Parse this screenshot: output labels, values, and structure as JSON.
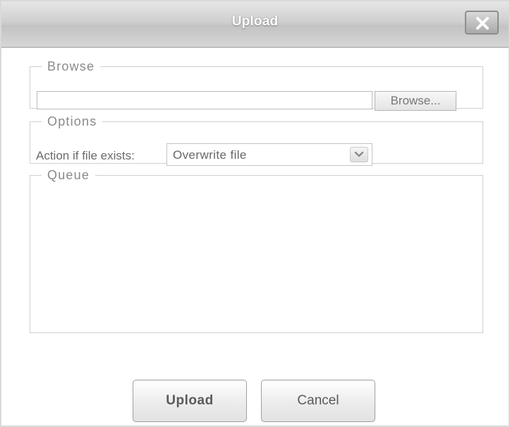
{
  "dialog": {
    "title": "Upload"
  },
  "browse_section": {
    "legend": "Browse",
    "file_value": "",
    "button_label": "Browse..."
  },
  "options_section": {
    "legend": "Options",
    "action_label": "Action if file exists:",
    "action_selected": "Overwrite file"
  },
  "queue_section": {
    "legend": "Queue",
    "items": []
  },
  "footer": {
    "upload_label": "Upload",
    "cancel_label": "Cancel"
  },
  "icons": {
    "close": "close-icon",
    "dropdown": "chevron-down-icon"
  }
}
